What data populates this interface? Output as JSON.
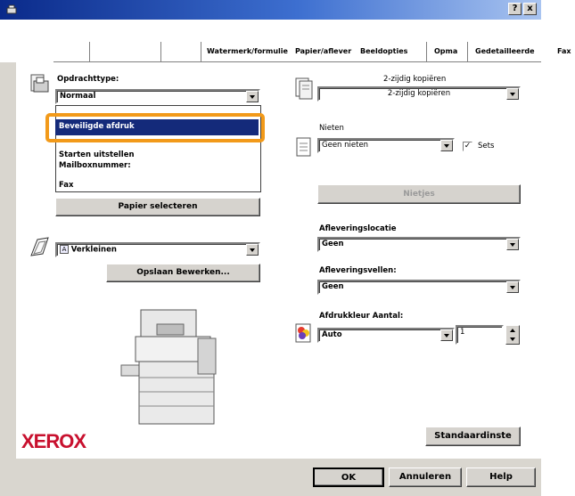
{
  "window": {
    "help_label": "?",
    "close_label": "x"
  },
  "tabs": [
    {
      "label": "Watermerk/formulie"
    },
    {
      "label": "Papier/aflever"
    },
    {
      "label": "Beeldopties"
    },
    {
      "label": "Opma"
    },
    {
      "label": "Gedetailleerde"
    },
    {
      "label": "Fax"
    }
  ],
  "job_type": {
    "label": "Opdrachttype:",
    "selected": "Normaal",
    "options": [
      "Beveiligde afdruk",
      "Starten uitstellen",
      "Mailboxnummer:",
      "Fax"
    ]
  },
  "paper_select_button": "Papier selecteren",
  "reduce": {
    "selected": "Verkleinen"
  },
  "save_edit_button": "Opslaan Bewerken...",
  "two_sided": {
    "label": "2-zijdig kopiëren",
    "selected": "2-zijdig kopiëren"
  },
  "staple": {
    "label": "Nieten",
    "selected": "Geen nieten",
    "sets_label": "Sets",
    "sets_checked": true
  },
  "staples_button": "Nietjes",
  "delivery_location": {
    "label": "Afleveringslocatie",
    "selected": "Geen"
  },
  "delivery_sheets": {
    "label": "Afleveringsvellen:",
    "selected": "Geen"
  },
  "print_color": {
    "label": "Afdrukkleur Aantal:",
    "selected": "Auto",
    "quantity": "1"
  },
  "brand": "XEROX",
  "defaults_button": "Standaardinste",
  "footer": {
    "ok": "OK",
    "cancel": "Annuleren",
    "help": "Help"
  },
  "colors": {
    "accent_callout": "#f29a1a",
    "selection": "#142a7a",
    "brand_red": "#c8102e"
  }
}
